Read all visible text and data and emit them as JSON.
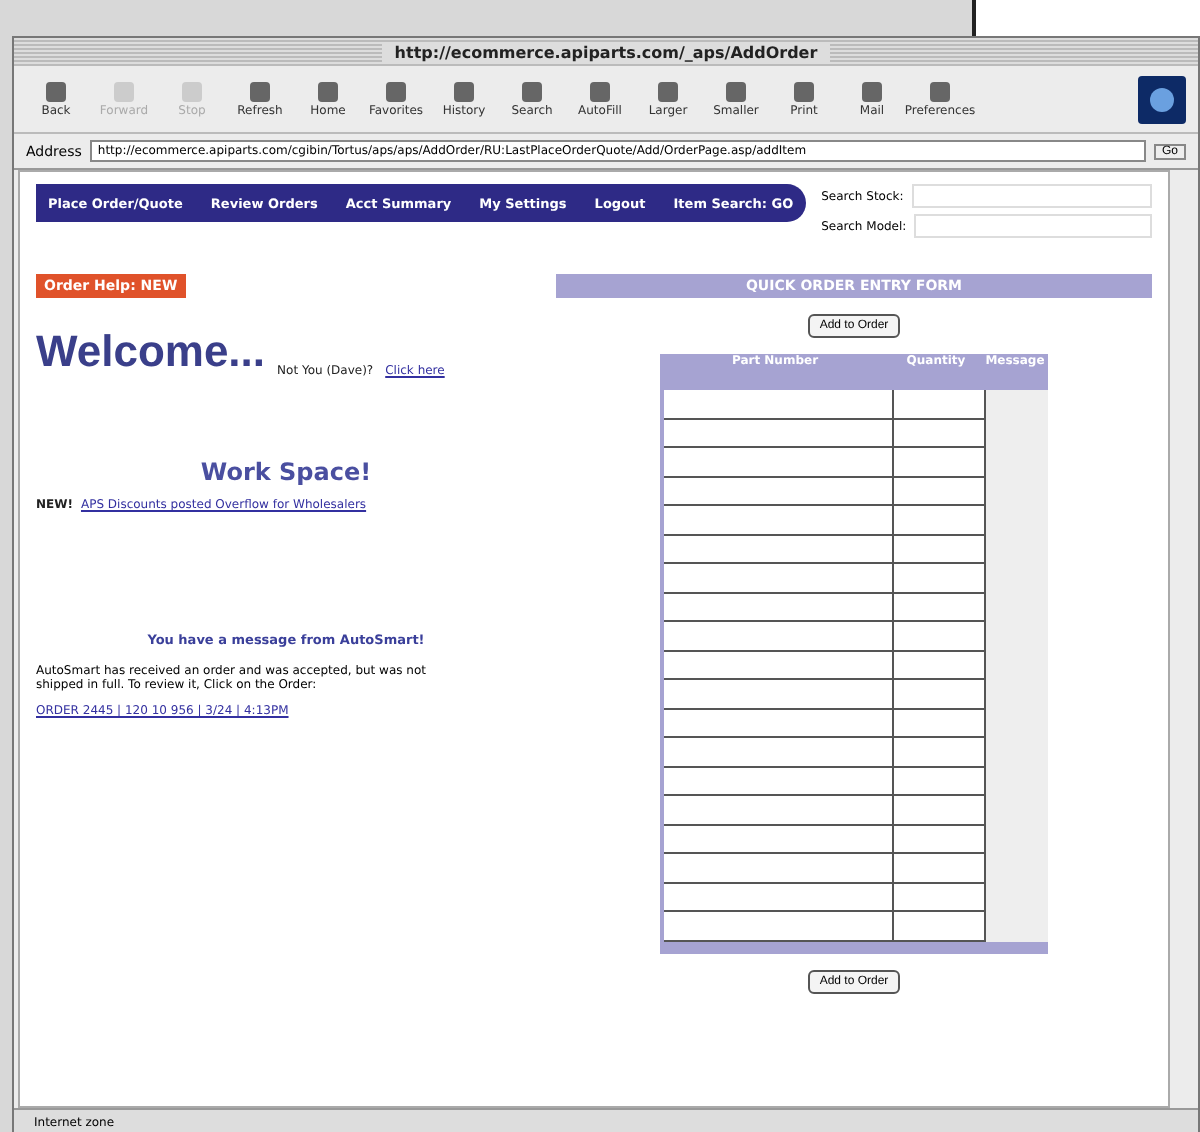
{
  "window": {
    "title": "http://ecommerce.apiparts.com/_aps/AddOrder"
  },
  "toolbar": [
    {
      "label": "Back",
      "disabled": false
    },
    {
      "label": "Forward",
      "disabled": true
    },
    {
      "label": "Stop",
      "disabled": true
    },
    {
      "label": "Refresh",
      "disabled": false
    },
    {
      "label": "Home",
      "disabled": false
    },
    {
      "label": "Favorites",
      "disabled": false
    },
    {
      "label": "History",
      "disabled": false
    },
    {
      "label": "Search",
      "disabled": false
    },
    {
      "label": "AutoFill",
      "disabled": false
    },
    {
      "label": "Larger",
      "disabled": false
    },
    {
      "label": "Smaller",
      "disabled": false
    },
    {
      "label": "Print",
      "disabled": false
    },
    {
      "label": "Mail",
      "disabled": false
    },
    {
      "label": "Preferences",
      "disabled": false
    }
  ],
  "address": {
    "label": "Address",
    "value": "http://ecommerce.apiparts.com/cgibin/Tortus/aps/aps/AddOrder/RU:LastPlaceOrderQuote/Add/OrderPage.asp/addItem",
    "go": "Go"
  },
  "nav": [
    "Place Order/Quote",
    "Review Orders",
    "Acct Summary",
    "My Settings",
    "Logout",
    "Item Search: GO"
  ],
  "search": [
    {
      "label": "Search Stock:"
    },
    {
      "label": "Search Model:"
    }
  ],
  "badge": "Order Help: NEW",
  "welcome": {
    "title": "Welcome...",
    "note": "Not You (Dave)?",
    "link": "Click here"
  },
  "workspace": {
    "title": "Work Space!",
    "new_label": "NEW!",
    "link": "APS Discounts posted Overflow for Wholesalers"
  },
  "message": {
    "title": "You have a message from AutoSmart!",
    "body": "AutoSmart has received an order and was accepted, but was not shipped in full. To review it, Click on the Order:",
    "link": "ORDER 2445 | 120 10 956 | 3/24 | 4:13PM"
  },
  "quick_order": {
    "title": "QUICK ORDER ENTRY FORM",
    "add_top": "Add to Order",
    "columns": [
      "Part Number",
      "Quantity",
      "Message"
    ],
    "add_bottom": "Add to Order"
  },
  "status_bar": "Internet zone"
}
